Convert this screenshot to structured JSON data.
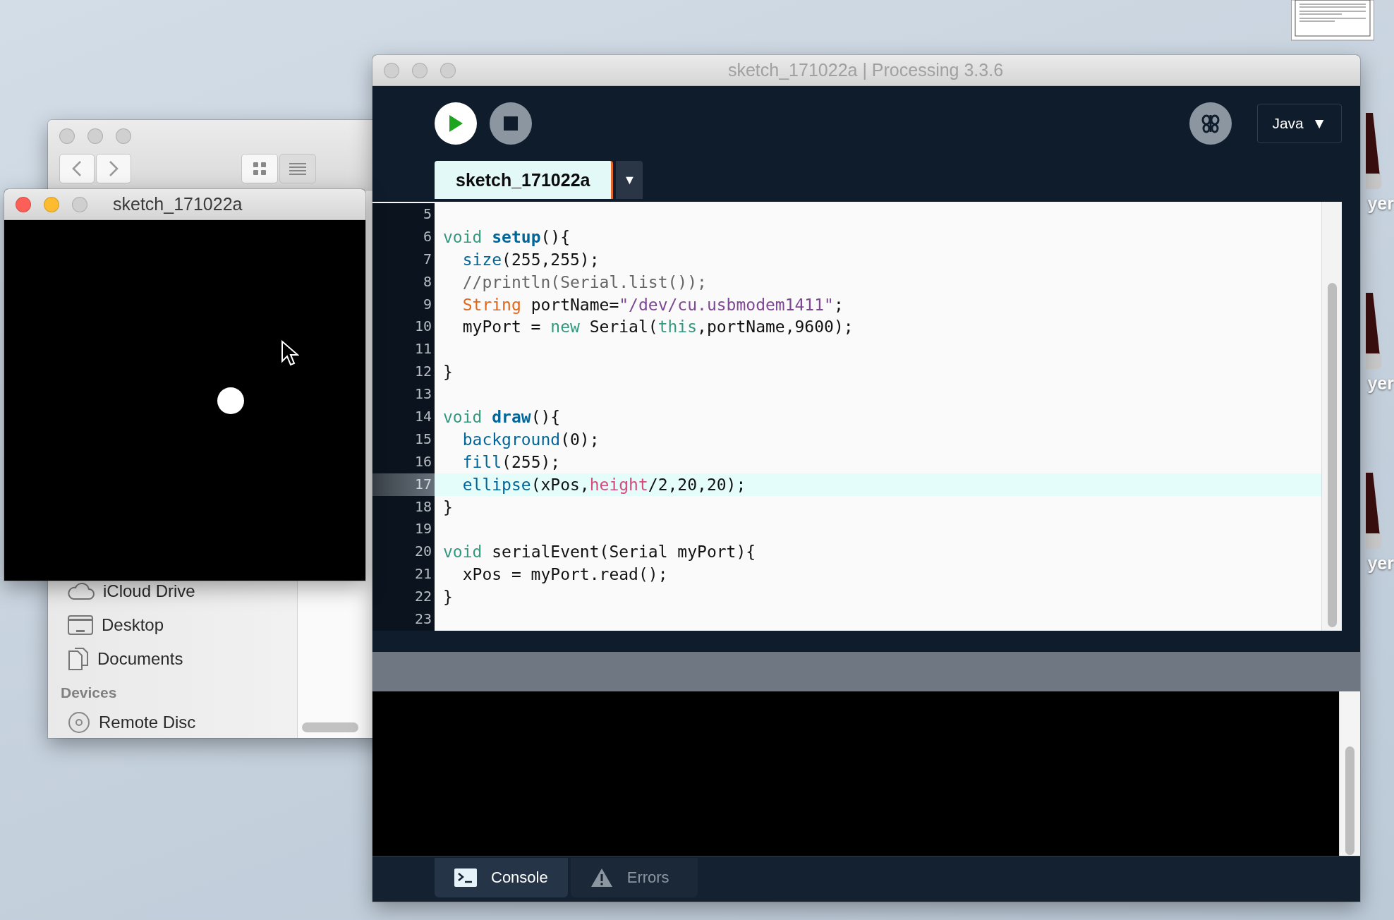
{
  "desktop": {
    "items": [
      {
        "label": "yer"
      },
      {
        "label": "yer"
      },
      {
        "label": "yer"
      }
    ]
  },
  "finder": {
    "active": false,
    "sidebar": [
      {
        "kind": "item",
        "label": "iCloud Drive"
      },
      {
        "kind": "item",
        "label": "Desktop"
      },
      {
        "kind": "item",
        "label": "Documents"
      },
      {
        "kind": "header",
        "label": "Devices"
      },
      {
        "kind": "item",
        "label": "Remote Disc"
      }
    ]
  },
  "sketch_window": {
    "title": "sketch_171022a",
    "active": true
  },
  "processing": {
    "title": "sketch_171022a | Processing 3.3.6",
    "active": false,
    "mode": {
      "label": "Java",
      "arrow": "▼"
    },
    "tabs": [
      {
        "label": "sketch_171022a",
        "selected": true
      }
    ],
    "tab_menu": "▼",
    "lines": [
      {
        "number": "5",
        "current": false
      },
      {
        "number": "6",
        "current": false,
        "tokens": [
          {
            "text": "void ",
            "kind": "keyword"
          },
          {
            "text": "setup",
            "kind": "function-bold"
          },
          {
            "text": "(){",
            "kind": "plain"
          }
        ]
      },
      {
        "number": "7",
        "current": false,
        "tokens": [
          {
            "text": "  size",
            "kind": "function"
          },
          {
            "text": "(255,255);",
            "kind": "plain"
          }
        ]
      },
      {
        "number": "8",
        "current": false,
        "tokens": [
          {
            "text": "  //println(Serial.list());",
            "kind": "comment"
          }
        ]
      },
      {
        "number": "9",
        "current": false,
        "tokens": [
          {
            "text": "  String",
            "kind": "type"
          },
          {
            "text": " portName=",
            "kind": "plain"
          },
          {
            "text": "\"/dev/cu.usbmodem1411\"",
            "kind": "string"
          },
          {
            "text": ";",
            "kind": "plain"
          }
        ]
      },
      {
        "number": "10",
        "current": false,
        "tokens": [
          {
            "text": "  myPort = ",
            "kind": "plain"
          },
          {
            "text": "new",
            "kind": "keyword"
          },
          {
            "text": " Serial(",
            "kind": "plain"
          },
          {
            "text": "this",
            "kind": "keyword"
          },
          {
            "text": ",portName,9600);",
            "kind": "plain"
          }
        ]
      },
      {
        "number": "11",
        "current": false
      },
      {
        "number": "12",
        "current": false,
        "tokens": [
          {
            "text": "}",
            "kind": "plain"
          }
        ]
      },
      {
        "number": "13",
        "current": false
      },
      {
        "number": "14",
        "current": false,
        "tokens": [
          {
            "text": "void ",
            "kind": "keyword"
          },
          {
            "text": "draw",
            "kind": "function-bold"
          },
          {
            "text": "(){",
            "kind": "plain"
          }
        ]
      },
      {
        "number": "15",
        "current": false,
        "tokens": [
          {
            "text": "  background",
            "kind": "function"
          },
          {
            "text": "(0);",
            "kind": "plain"
          }
        ]
      },
      {
        "number": "16",
        "current": false,
        "tokens": [
          {
            "text": "  fill",
            "kind": "function"
          },
          {
            "text": "(255);",
            "kind": "plain"
          }
        ]
      },
      {
        "number": "17",
        "current": true,
        "tokens": [
          {
            "text": "  ellipse",
            "kind": "function"
          },
          {
            "text": "(xPos,",
            "kind": "plain"
          },
          {
            "text": "height",
            "kind": "constant"
          },
          {
            "text": "/2,20,20);",
            "kind": "plain"
          }
        ]
      },
      {
        "number": "18",
        "current": false,
        "tokens": [
          {
            "text": "}",
            "kind": "plain"
          }
        ]
      },
      {
        "number": "19",
        "current": false
      },
      {
        "number": "20",
        "current": false,
        "tokens": [
          {
            "text": "void",
            "kind": "keyword"
          },
          {
            "text": " serialEvent(Serial myPort){",
            "kind": "plain"
          }
        ]
      },
      {
        "number": "21",
        "current": false,
        "tokens": [
          {
            "text": "  xPos = myPort.read();",
            "kind": "plain"
          }
        ]
      },
      {
        "number": "22",
        "current": false,
        "tokens": [
          {
            "text": "}",
            "kind": "plain"
          }
        ]
      },
      {
        "number": "23",
        "current": false
      }
    ],
    "console_tabs": [
      {
        "label": "Console",
        "selected": true
      },
      {
        "label": "Errors",
        "selected": false
      }
    ]
  }
}
